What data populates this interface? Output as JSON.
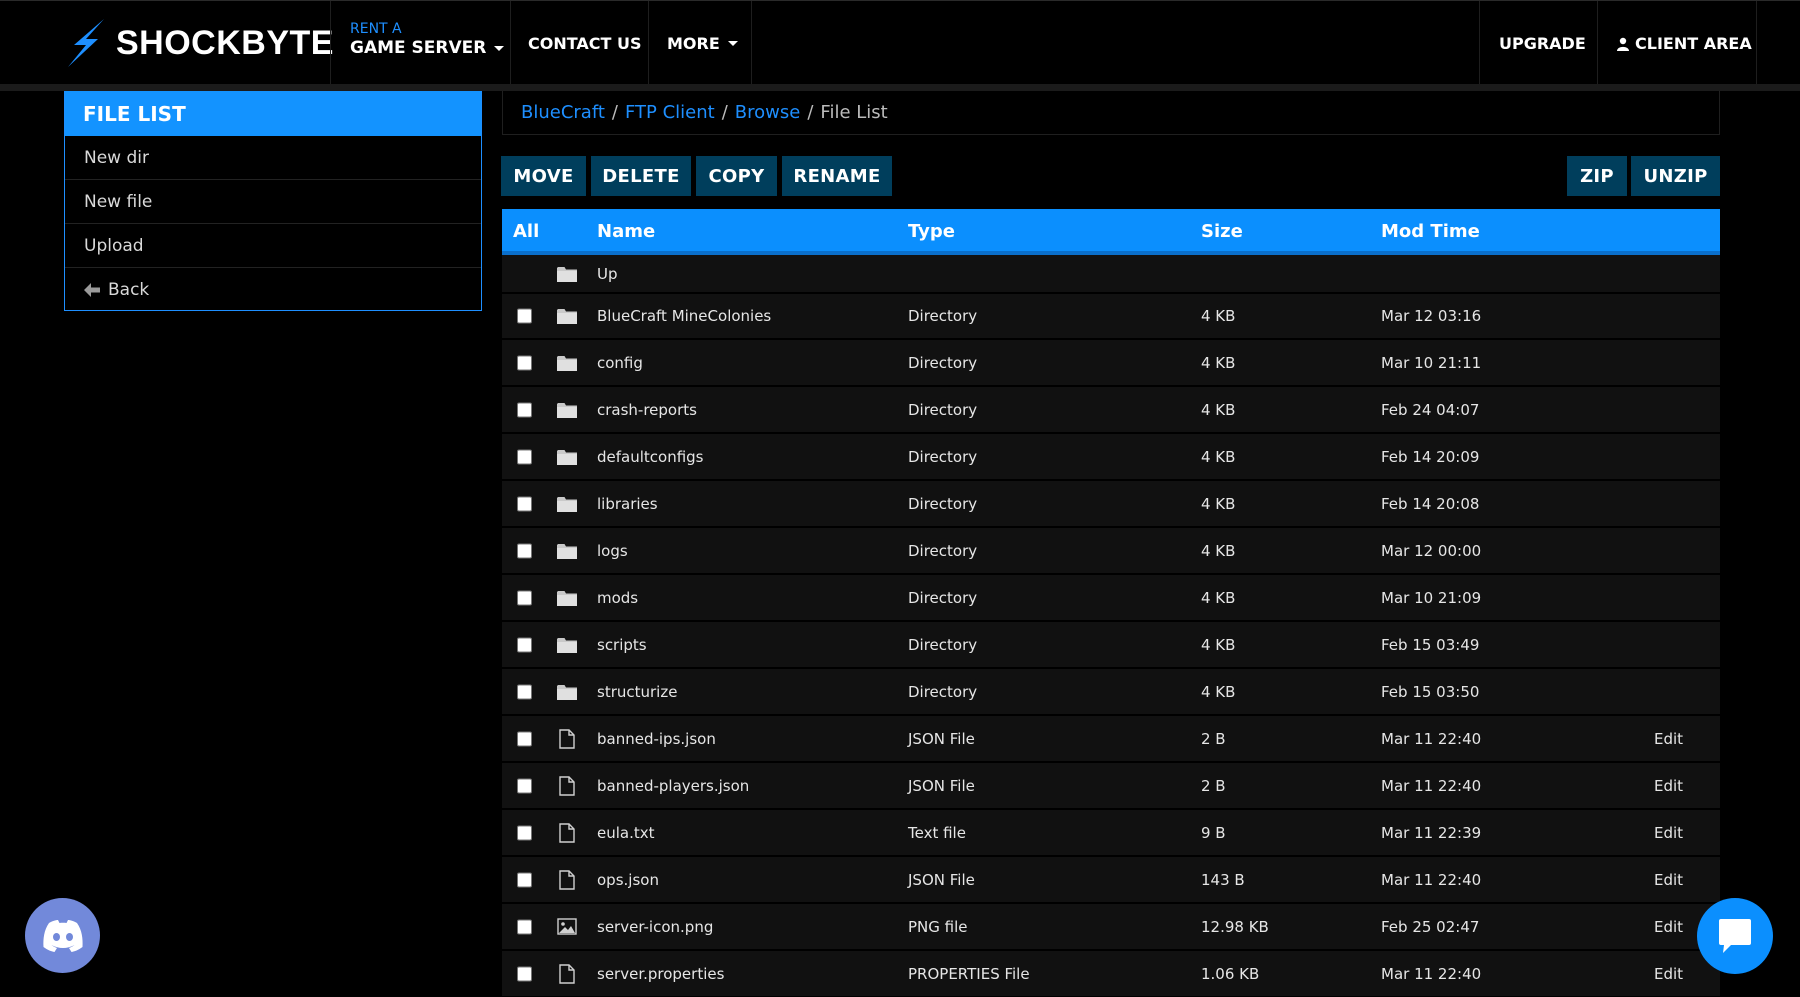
{
  "brand": {
    "name": "SHOCKBYTE"
  },
  "nav": {
    "rent_small": "RENT A",
    "rent_big": "GAME SERVER",
    "contact": "CONTACT US",
    "more": "MORE",
    "upgrade": "UPGRADE",
    "client_area": "CLIENT AREA"
  },
  "sidebar": {
    "title": "FILE LIST",
    "items": [
      {
        "label": "New dir"
      },
      {
        "label": "New file"
      },
      {
        "label": "Upload"
      },
      {
        "label": "Back"
      }
    ]
  },
  "breadcrumb": {
    "links": [
      "BlueCraft",
      "FTP Client",
      "Browse"
    ],
    "current": "File List",
    "separator": "/"
  },
  "toolbar": {
    "move": "MOVE",
    "delete": "DELETE",
    "copy": "COPY",
    "rename": "RENAME",
    "zip": "ZIP",
    "unzip": "UNZIP"
  },
  "table": {
    "headers": {
      "all": "All",
      "name": "Name",
      "type": "Type",
      "size": "Size",
      "mod_time": "Mod Time"
    },
    "up_label": "Up",
    "edit_label": "Edit",
    "rows": [
      {
        "name": "BlueCraft MineColonies",
        "type": "Directory",
        "size": "4 KB",
        "mod": "Mar 12 03:16",
        "icon": "folder-icon",
        "editable": false
      },
      {
        "name": "config",
        "type": "Directory",
        "size": "4 KB",
        "mod": "Mar 10 21:11",
        "icon": "folder-icon",
        "editable": false
      },
      {
        "name": "crash-reports",
        "type": "Directory",
        "size": "4 KB",
        "mod": "Feb 24 04:07",
        "icon": "folder-icon",
        "editable": false
      },
      {
        "name": "defaultconfigs",
        "type": "Directory",
        "size": "4 KB",
        "mod": "Feb 14 20:09",
        "icon": "folder-icon",
        "editable": false
      },
      {
        "name": "libraries",
        "type": "Directory",
        "size": "4 KB",
        "mod": "Feb 14 20:08",
        "icon": "folder-icon",
        "editable": false
      },
      {
        "name": "logs",
        "type": "Directory",
        "size": "4 KB",
        "mod": "Mar 12 00:00",
        "icon": "folder-icon",
        "editable": false
      },
      {
        "name": "mods",
        "type": "Directory",
        "size": "4 KB",
        "mod": "Mar 10 21:09",
        "icon": "folder-icon",
        "editable": false
      },
      {
        "name": "scripts",
        "type": "Directory",
        "size": "4 KB",
        "mod": "Feb 15 03:49",
        "icon": "folder-icon",
        "editable": false
      },
      {
        "name": "structurize",
        "type": "Directory",
        "size": "4 KB",
        "mod": "Feb 15 03:50",
        "icon": "folder-icon",
        "editable": false
      },
      {
        "name": "banned-ips.json",
        "type": "JSON File",
        "size": "2 B",
        "mod": "Mar 11 22:40",
        "icon": "file-icon",
        "editable": true
      },
      {
        "name": "banned-players.json",
        "type": "JSON File",
        "size": "2 B",
        "mod": "Mar 11 22:40",
        "icon": "file-icon",
        "editable": true
      },
      {
        "name": "eula.txt",
        "type": "Text file",
        "size": "9 B",
        "mod": "Mar 11 22:39",
        "icon": "file-icon",
        "editable": true
      },
      {
        "name": "ops.json",
        "type": "JSON File",
        "size": "143 B",
        "mod": "Mar 11 22:40",
        "icon": "file-icon",
        "editable": true
      },
      {
        "name": "server-icon.png",
        "type": "PNG file",
        "size": "12.98 KB",
        "mod": "Feb 25 02:47",
        "icon": "image-icon",
        "editable": true
      },
      {
        "name": "server.properties",
        "type": "PROPERTIES File",
        "size": "1.06 KB",
        "mod": "Mar 11 22:40",
        "icon": "file-icon",
        "editable": true
      }
    ]
  },
  "colors": {
    "accent": "#1393ff",
    "button_bg": "#003e5c",
    "link": "#1e8fff",
    "discord": "#7289da",
    "row_bg": "#111111"
  }
}
